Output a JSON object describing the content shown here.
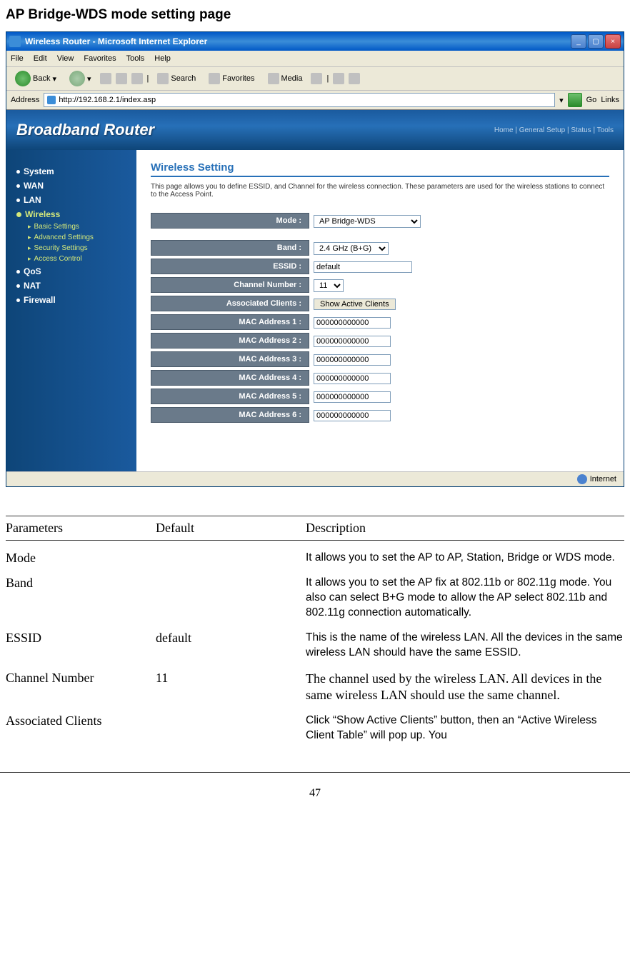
{
  "page_title": "AP Bridge-WDS mode setting page",
  "browser": {
    "window_title": "Wireless Router - Microsoft Internet Explorer",
    "menu": {
      "file": "File",
      "edit": "Edit",
      "view": "View",
      "favorites": "Favorites",
      "tools": "Tools",
      "help": "Help"
    },
    "toolbar": {
      "back": "Back",
      "search": "Search",
      "favorites": "Favorites",
      "media": "Media"
    },
    "address_label": "Address",
    "address_value": "http://192.168.2.1/index.asp",
    "go": "Go",
    "links": "Links",
    "status": "Internet"
  },
  "router": {
    "brand": "Broadband Router",
    "top_links": "Home | General Setup | Status | Tools",
    "sidebar": {
      "system": "System",
      "wan": "WAN",
      "lan": "LAN",
      "wireless": "Wireless",
      "sub": {
        "basic": "Basic Settings",
        "advanced": "Advanced Settings",
        "security": "Security Settings",
        "access": "Access Control"
      },
      "qos": "QoS",
      "nat": "NAT",
      "firewall": "Firewall"
    },
    "section": {
      "title": "Wireless Setting",
      "desc": "This page allows you to define ESSID, and Channel for the wireless connection. These parameters are used for the wireless stations to connect to the Access Point."
    },
    "form": {
      "mode_label": "Mode :",
      "mode_value": "AP Bridge-WDS",
      "band_label": "Band :",
      "band_value": "2.4 GHz (B+G)",
      "essid_label": "ESSID :",
      "essid_value": "default",
      "channel_label": "Channel Number :",
      "channel_value": "11",
      "assoc_label": "Associated Clients :",
      "assoc_button": "Show Active Clients",
      "mac1_label": "MAC Address 1 :",
      "mac2_label": "MAC Address 2 :",
      "mac3_label": "MAC Address 3 :",
      "mac4_label": "MAC Address 4 :",
      "mac5_label": "MAC Address 5 :",
      "mac6_label": "MAC Address 6 :",
      "mac_value": "000000000000"
    }
  },
  "table": {
    "headers": {
      "c1": "Parameters",
      "c2": "Default",
      "c3": "Description"
    },
    "rows": {
      "mode": {
        "p": "Mode",
        "d": "",
        "desc": "It allows you to set the AP to AP, Station, Bridge or WDS mode."
      },
      "band": {
        "p": "Band",
        "d": "",
        "desc": "It allows you to set the AP fix at 802.11b or 802.11g mode. You also can select B+G mode to allow the AP select 802.11b and 802.11g connection automatically."
      },
      "essid": {
        "p": "ESSID",
        "d": "default",
        "desc": "This is the name of the wireless LAN. All the devices in the same wireless LAN should have the same ESSID."
      },
      "channel": {
        "p": "Channel Number",
        "d": "11",
        "desc": "The channel used by the wireless LAN. All devices in the same wireless LAN should use the same channel."
      },
      "assoc": {
        "p": "Associated Clients",
        "d": "",
        "desc": "Click “Show Active Clients” button, then an “Active Wireless Client Table” will pop up. You"
      }
    }
  },
  "page_number": "47"
}
